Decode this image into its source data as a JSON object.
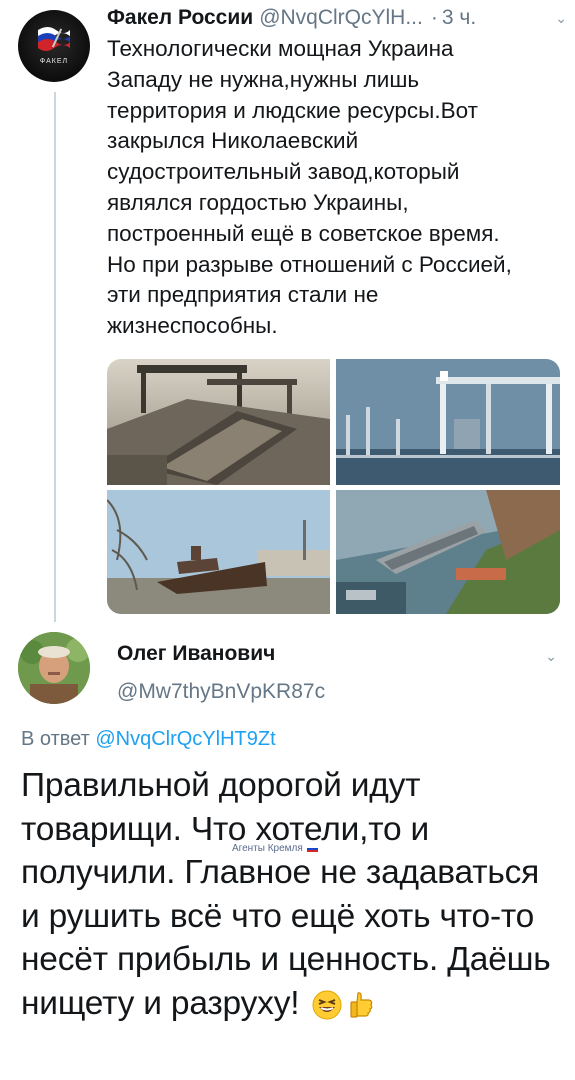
{
  "tweet1": {
    "author_name": "Факел России",
    "author_handle": "@NvqClrQcYlH...",
    "separator": "·",
    "time": "3 ч.",
    "text": "Технологически мощная Украина\nЗападу не нужна,нужны лишь\nтерритория и людские ресурсы.Вот\nзакрылся Николаевский\nсудостроительный завод,который\nявлялся гордостью Украины,\nпостроенный ещё в советское время.\nНо при разрыве отношений с Россией,\nэти предприятия стали не\nжизнеспособны.",
    "avatar_text": "ФАКЕЛ",
    "photos": [
      "shipyard-historic-photo",
      "gantry-cranes-photo",
      "rusted-ship-photo",
      "aerial-shipyard-photo"
    ]
  },
  "tweet2": {
    "author_name": "Олег Иванович",
    "author_handle": "@Mw7thyBnVpKR87c",
    "reply_prefix": "В ответ",
    "reply_mention": "@NvqClrQcYlHT9Zt",
    "text": "Правильной дорогой идут товарищи. Что хотели,то и получили. Главное не задаваться и рушить всё что ещё хоть что-то несёт прибыль и ценность. Даёшь нищету и разруху!",
    "emojis": [
      "grinning-squint-emoji",
      "thumbs-up-emoji"
    ]
  },
  "watermark": {
    "text": "Агенты Кремля"
  },
  "colors": {
    "text": "#14171a",
    "secondary": "#657786",
    "link": "#1da1f2",
    "thread_line": "#ccd6dd"
  },
  "icons": {
    "chevron": "chevron-down-icon"
  }
}
